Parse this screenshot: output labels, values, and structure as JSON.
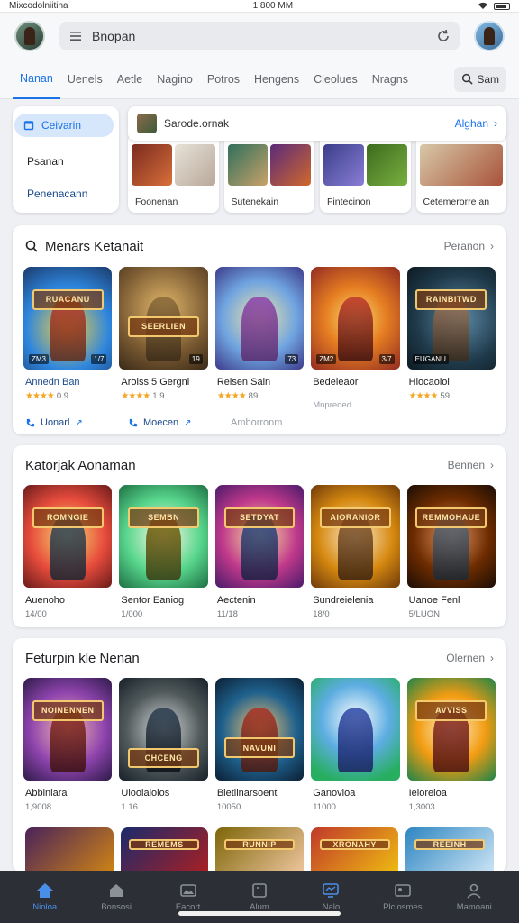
{
  "status": {
    "left": "Mixcodolniitina",
    "time": "1:800 MM"
  },
  "search": {
    "text": "Bnopan"
  },
  "tabs": [
    "Nanan",
    "Uenels",
    "Aetle",
    "Nagino",
    "Potros",
    "Hengens",
    "Cleolues",
    "Nragns"
  ],
  "tab_search_label": "Sam",
  "left_card": {
    "pill": "Ceivarin",
    "item1": "Psanan",
    "item2": "Penenacann"
  },
  "promo": {
    "text": "Sarode.ornak",
    "link": "Alghan"
  },
  "minicards": [
    "Foonenan",
    "Sutenekain",
    "Fintecinon",
    "Cetemerorre an"
  ],
  "section1": {
    "title": "Menars Ketanait",
    "more": "Peranon",
    "cards": [
      {
        "name": "Annedn Ban",
        "rating": "0.9",
        "banner": "RUACANU",
        "badge": "ZM3",
        "badge2": "1/7"
      },
      {
        "name": "Aroiss 5 Gergnl",
        "rating": "1.9",
        "banner": "SEERLIEN",
        "badge": "",
        "badge2": "19"
      },
      {
        "name": "Reisen Sain",
        "rating": "89",
        "banner": "",
        "badge": "",
        "badge2": "73"
      },
      {
        "name": "Bedeleaor",
        "rating": "",
        "sub": "Mnpreoed",
        "banner": "",
        "badge": "ZM2",
        "badge2": "3/7"
      },
      {
        "name": "Hlocaolol",
        "rating": "59",
        "banner": "RAINBITWD",
        "badge": "EUGANU",
        "badge2": ""
      }
    ],
    "actions": {
      "a1": "Uonarl",
      "a2": "Moecen",
      "a3": "Amborronm"
    }
  },
  "section2": {
    "title": "Katorjak Aonaman",
    "more": "Bennen",
    "cards": [
      {
        "name": "Auenoho",
        "meta": "14/00",
        "banner": "ROMNGIE"
      },
      {
        "name": "Sentor Eaniog",
        "meta": "1/000",
        "banner": "SEMBN"
      },
      {
        "name": "Aectenin",
        "meta": "11/18",
        "banner": "SETDYAT"
      },
      {
        "name": "Sundreielenia",
        "meta": "18/0",
        "banner": "AIORANIOR"
      },
      {
        "name": "Uanoe Fenl",
        "meta": "5/LUON",
        "banner": "REMMOHAUE"
      }
    ]
  },
  "section3": {
    "title": "Feturpin kle Nenan",
    "more": "Olernen",
    "cards": [
      {
        "name": "Abbinlara",
        "meta": "1,9008",
        "banner": "NOINENNEN"
      },
      {
        "name": "Uloolaiolos",
        "meta": "1 16",
        "banner": "CHCENG"
      },
      {
        "name": "Bletlinarsoent",
        "meta": "10050",
        "banner": "NAVUNI"
      },
      {
        "name": "Ganovloa",
        "meta": "11000",
        "banner": ""
      },
      {
        "name": "Ieloreioa",
        "meta": "1,3003",
        "banner": "AVVISS"
      }
    ],
    "peek": [
      "",
      "REMEMS",
      "RUNNIP",
      "XRONAHY",
      "REEINH"
    ]
  },
  "nav": [
    {
      "label": "Nioloa",
      "icon": "home-icon"
    },
    {
      "label": "Bonsosi",
      "icon": "store-icon"
    },
    {
      "label": "Eacort",
      "icon": "image-icon"
    },
    {
      "label": "Alum",
      "icon": "card-icon"
    },
    {
      "label": "Nalo",
      "icon": "monitor-icon"
    },
    {
      "label": "Plclosmes",
      "icon": "gallery-icon"
    },
    {
      "label": "Mamoani",
      "icon": "profile-icon"
    }
  ],
  "colors": {
    "accent": "#1a73e8",
    "nav_bg": "#2c2f36",
    "star": "#f5a623"
  }
}
